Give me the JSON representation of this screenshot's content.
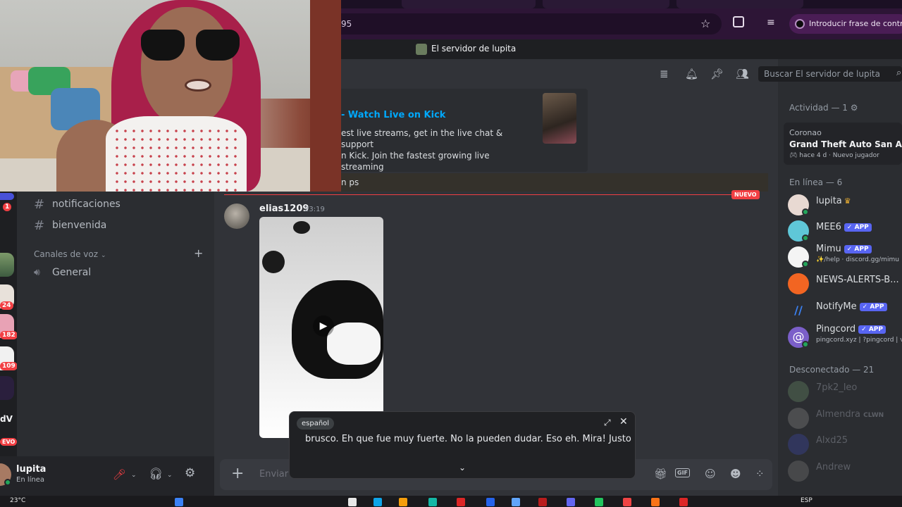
{
  "browser": {
    "url_fragment": "95",
    "passphrase_label": "Introducir frase de contrase"
  },
  "server": {
    "title": "El servidor de lupita",
    "search_placeholder": "Buscar El servidor de lupita"
  },
  "guilds": {
    "badges": [
      "1",
      "24",
      "182",
      "109"
    ],
    "label_dv": "dV",
    "label_nuevo": "EVO"
  },
  "channels": {
    "text": [
      {
        "name": "notificaciones"
      },
      {
        "name": "bienvenida"
      }
    ],
    "voice_category": "Canales de voz",
    "voice": [
      {
        "name": "General"
      }
    ]
  },
  "user_panel": {
    "name": "lupita",
    "status": "En línea"
  },
  "embed": {
    "title": "Watch Live on Kick",
    "description_line1": "est live streams, get in the live chat & support",
    "description_line2": "n Kick. Join the fastest growing live streaming"
  },
  "reply": {
    "text": "n ps"
  },
  "new_divider": {
    "label": "NUEVO"
  },
  "message": {
    "author": "elias1209",
    "time": "23:19"
  },
  "composer": {
    "placeholder": "Enviar"
  },
  "caption": {
    "language": "español",
    "text": "brusco. Eh que fue muy fuerte. No la pueden dudar. Eso eh. Mira! Justo"
  },
  "members": {
    "activity_header": "Actividad — 1",
    "activity": {
      "user": "Coronao",
      "game": "Grand Theft Auto San Andr...",
      "elapsed": "hace 4 d",
      "tag": "Nuevo jugador"
    },
    "online_header": "En línea — 6",
    "online": [
      {
        "name": "lupita",
        "app": false,
        "sub": ""
      },
      {
        "name": "MEE6",
        "app": true,
        "sub": ""
      },
      {
        "name": "Mimu",
        "app": true,
        "sub": "✨/help · discord.gg/mimu"
      },
      {
        "name": "NEWS-ALERTS-B...",
        "app": false,
        "sub": ""
      },
      {
        "name": "NotifyMe",
        "app": true,
        "sub": ""
      },
      {
        "name": "Pingcord",
        "app": true,
        "sub": "pingcord.xyz | ?pingcord | v"
      }
    ],
    "app_tag": "APP",
    "offline_header": "Desconectado — 21",
    "offline": [
      {
        "name": "7pk2_leo",
        "tag": ""
      },
      {
        "name": "Almendra",
        "tag": "CLWN"
      },
      {
        "name": "Alxd25",
        "tag": ""
      },
      {
        "name": "Andrew",
        "tag": ""
      }
    ]
  },
  "taskbar": {
    "weather": "23°C",
    "lang": "ESP"
  },
  "colors": {
    "background": "#313338",
    "sidebar": "#2b2d31",
    "accent": "#5865f2",
    "link": "#00a8fc",
    "danger": "#f23f43",
    "online": "#23a55a"
  }
}
